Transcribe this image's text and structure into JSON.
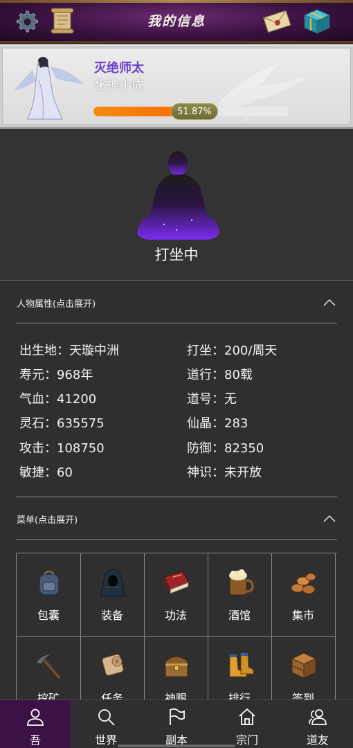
{
  "header": {
    "title": "我的信息",
    "icons": [
      "gear-icon",
      "scroll-icon",
      "mail-icon",
      "gift-icon"
    ]
  },
  "profile": {
    "name": "灭绝师太",
    "realm": "化神小成",
    "progress_percent": 51.87,
    "progress_label": "51.87%",
    "name_color": "#6b3fc9",
    "progress_color": "#f28a12"
  },
  "meditation": {
    "status": "打坐中"
  },
  "attributes": {
    "title": "人物属性(点击展开)",
    "left": [
      "出生地：天璇中洲",
      "寿元：968年",
      "气血：41200",
      "灵石：635575",
      "攻击：108750",
      "敏捷：60"
    ],
    "right": [
      "打坐：200/周天",
      "道行：80载",
      "道号：无",
      "仙晶：283",
      "防御：82350",
      "神识：未开放"
    ]
  },
  "menu": {
    "title": "菜单(点击展开)",
    "items": [
      {
        "label": "包囊",
        "icon": "backpack-icon"
      },
      {
        "label": "装备",
        "icon": "cloak-icon"
      },
      {
        "label": "功法",
        "icon": "book-icon"
      },
      {
        "label": "酒馆",
        "icon": "beer-mug-icon"
      },
      {
        "label": "集市",
        "icon": "coins-icon"
      },
      {
        "label": "挖矿",
        "icon": "pickaxe-icon"
      },
      {
        "label": "任务",
        "icon": "scroll-icon"
      },
      {
        "label": "神赐",
        "icon": "treasure-chest-icon"
      },
      {
        "label": "排行",
        "icon": "boots-icon"
      },
      {
        "label": "签到",
        "icon": "crate-icon"
      }
    ]
  },
  "nav": {
    "items": [
      {
        "label": "吾",
        "icon": "person-icon",
        "active": true
      },
      {
        "label": "世界",
        "icon": "search-icon",
        "active": false
      },
      {
        "label": "副本",
        "icon": "flag-icon",
        "active": false
      },
      {
        "label": "宗门",
        "icon": "home-icon",
        "active": false
      },
      {
        "label": "道友",
        "icon": "friends-icon",
        "active": false
      }
    ]
  }
}
